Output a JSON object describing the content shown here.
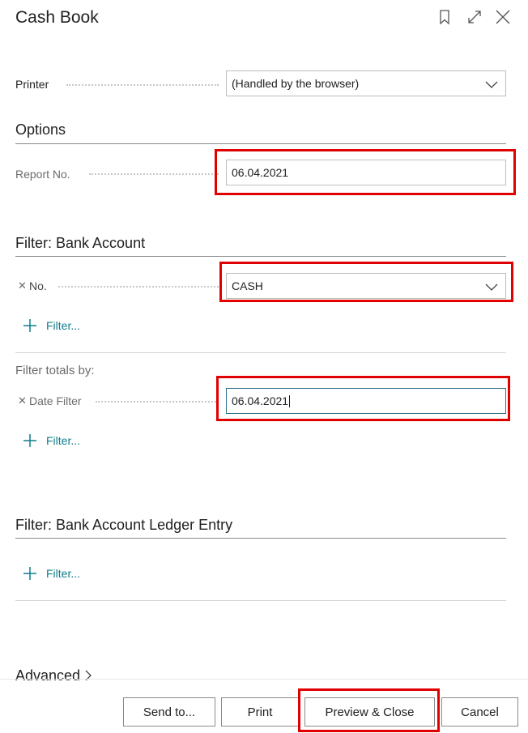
{
  "dialog": {
    "title": "Cash Book"
  },
  "printer": {
    "label": "Printer",
    "value": "(Handled by the browser)"
  },
  "options": {
    "heading": "Options",
    "report_no_label": "Report No.",
    "report_no_value": "06.04.2021"
  },
  "filter_bank_account": {
    "heading": "Filter: Bank Account",
    "no_label": "No.",
    "no_value": "CASH",
    "add_filter": "Filter...",
    "totals_heading": "Filter totals by:",
    "date_filter_label": "Date Filter",
    "date_filter_value": "06.04.2021",
    "totals_add_filter": "Filter..."
  },
  "filter_ledger": {
    "heading": "Filter: Bank Account Ledger Entry",
    "add_filter": "Filter..."
  },
  "advanced": {
    "label": "Advanced"
  },
  "buttons": {
    "send_to": "Send to...",
    "print": "Print",
    "preview_close": "Preview & Close",
    "cancel": "Cancel"
  },
  "colors": {
    "highlight": "#e00000",
    "link": "#0f7d8c",
    "focus_border": "#2f6f8c"
  }
}
